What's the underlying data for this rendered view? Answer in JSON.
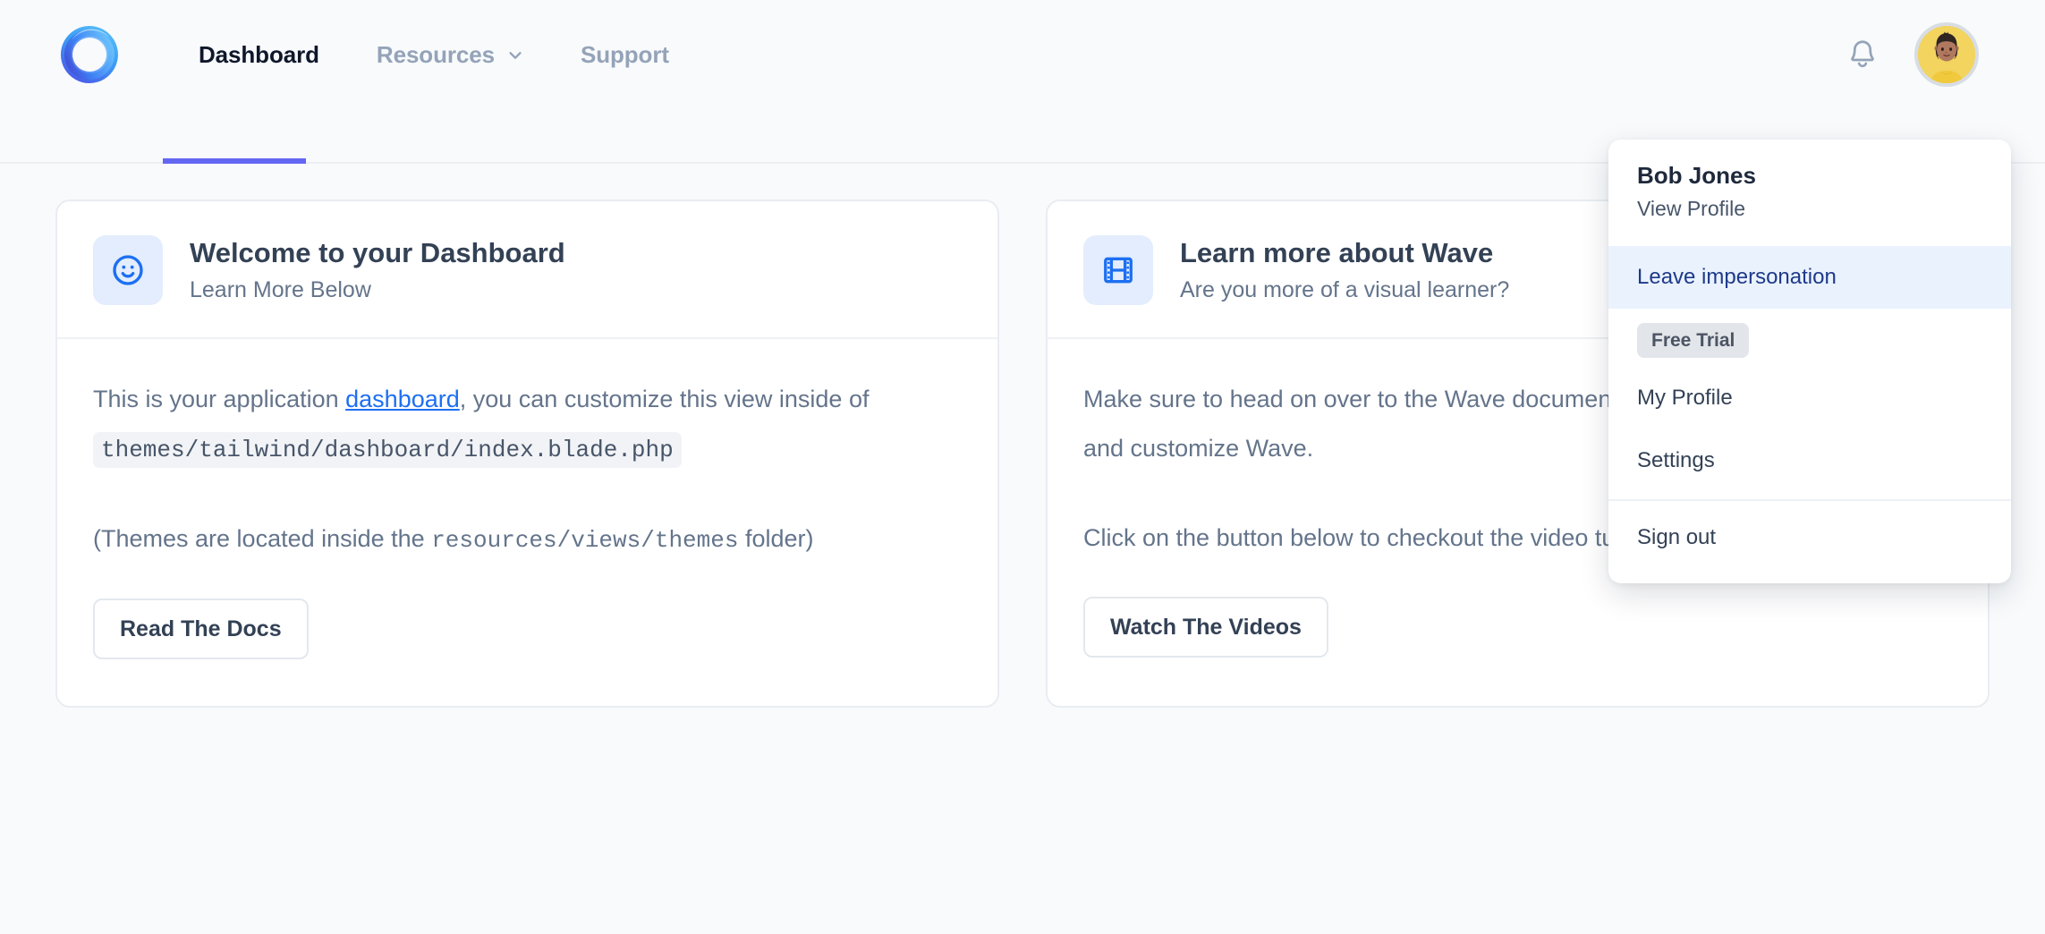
{
  "brand": {
    "logo_icon": "wave-ring-logo",
    "accent_color": "#6366f1",
    "link_color": "#1d6ff2",
    "icon_blue": "#1d6ff2"
  },
  "nav": {
    "items": [
      {
        "label": "Dashboard",
        "active": true,
        "has_caret": false
      },
      {
        "label": "Resources",
        "active": false,
        "has_caret": true
      },
      {
        "label": "Support",
        "active": false,
        "has_caret": false
      }
    ],
    "bell_icon": "bell-icon",
    "avatar_icon": "user-avatar"
  },
  "dropdown": {
    "name": "Bob Jones",
    "view_profile": "View Profile",
    "leave_impersonation": "Leave impersonation",
    "badge": "Free Trial",
    "my_profile": "My Profile",
    "settings": "Settings",
    "sign_out": "Sign out",
    "highlight_bg": "#eaf2fd",
    "highlight_text": "#1e3a8a"
  },
  "cards": [
    {
      "icon": "smiley-face-icon",
      "title": "Welcome to your Dashboard",
      "subtitle": "Learn More Below",
      "body_line1_pre": "This is your application ",
      "body_link": "dashboard",
      "body_line1_post": ", you can customize this view inside of ",
      "body_code": "themes/tailwind/dashboard/index.blade.php",
      "body_line2_pre": "(Themes are located inside the ",
      "body_code2": "resources/views/themes",
      "body_line2_post": " folder)",
      "button": "Read The Docs"
    },
    {
      "icon": "film-strip-icon",
      "title": "Learn more about Wave",
      "subtitle": "Are you more of a visual learner?",
      "body_line1": "Make sure to head on over to the Wave documentation to learn more how to use and customize Wave.",
      "body_line2": "Click on the button below to checkout the video tutorials.",
      "button": "Watch The Videos"
    }
  ]
}
